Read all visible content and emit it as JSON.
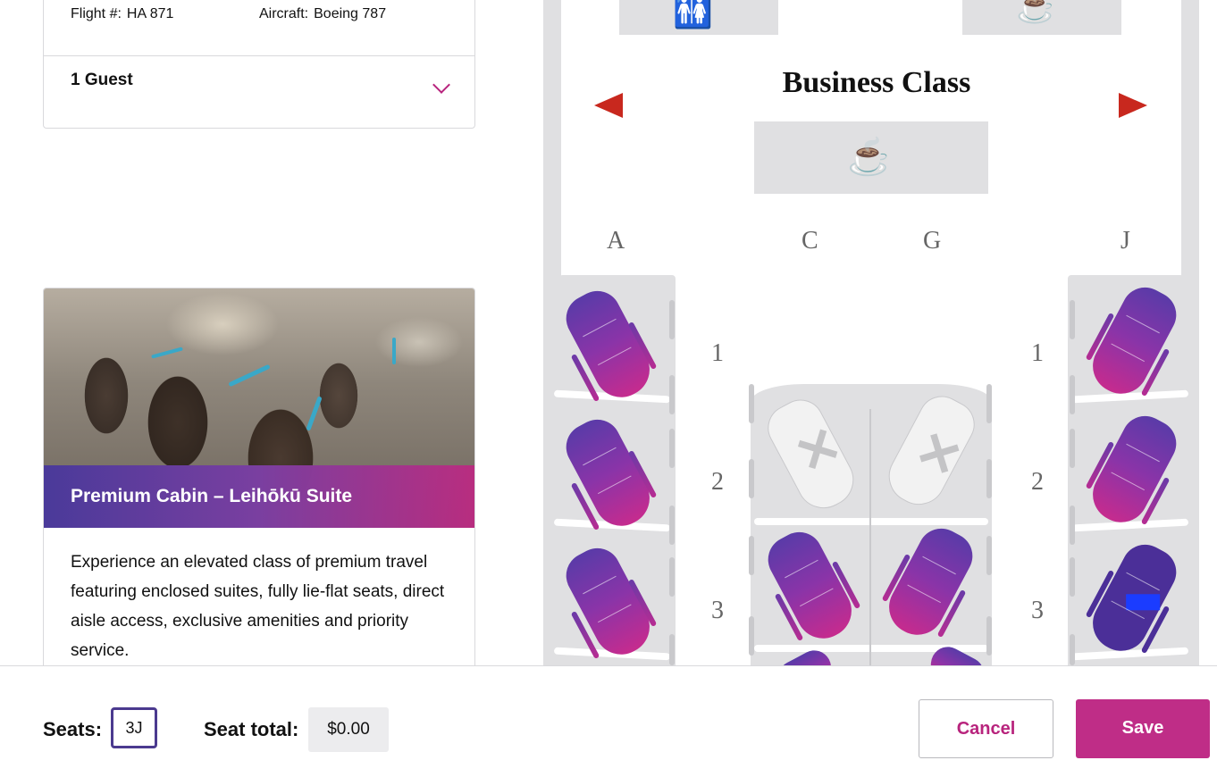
{
  "flight": {
    "flight_label": "Flight #:",
    "flight_number": "HA 871",
    "aircraft_label": "Aircraft:",
    "aircraft": "Boeing 787"
  },
  "guests": {
    "label": "1 Guest"
  },
  "cabin": {
    "title": "Premium Cabin – Leihōkū Suite",
    "description": "Experience an elevated class of premium travel featuring enclosed suites, fully lie-flat seats, direct aisle access, exclusive amenities and priority service."
  },
  "seatmap": {
    "class_title": "Business Class",
    "columns": [
      "A",
      "C",
      "G",
      "J"
    ],
    "rows": [
      "1",
      "2",
      "3"
    ],
    "colors": {
      "available_top": "#5a3ba8",
      "available_bottom": "#c62b8e",
      "selected": "#4b2f98",
      "nav_arrow": "#c8281e"
    }
  },
  "footer": {
    "seats_label": "Seats:",
    "seats_value": "3J",
    "total_label": "Seat total:",
    "total_value": "$0.00",
    "cancel_label": "Cancel",
    "save_label": "Save"
  }
}
